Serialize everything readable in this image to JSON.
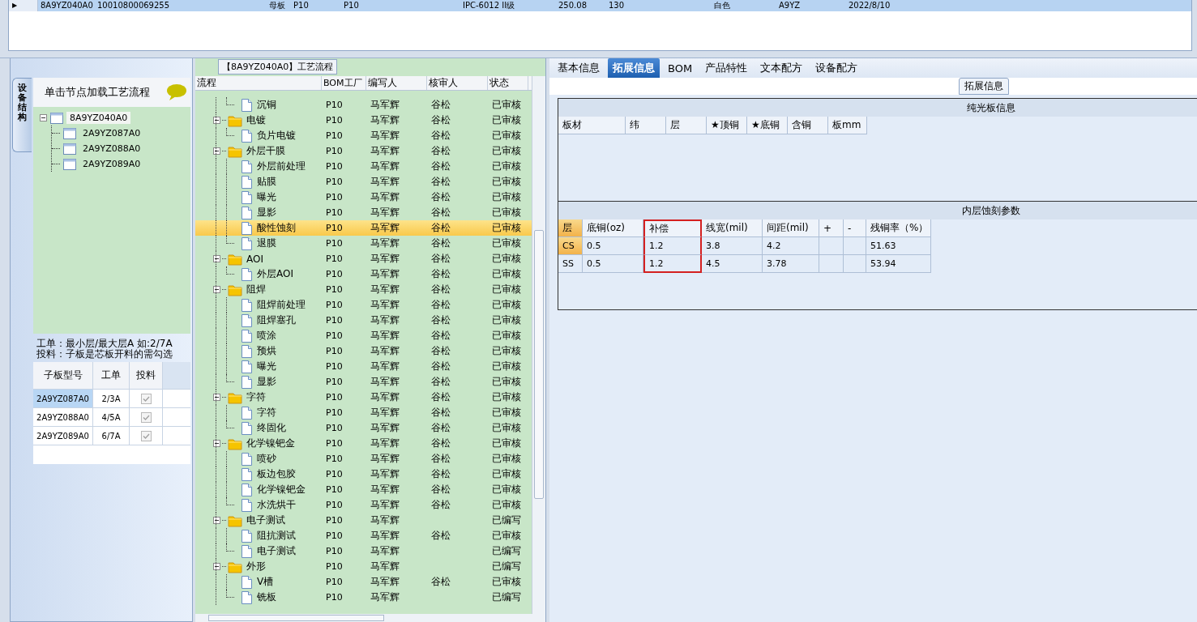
{
  "top_grid": {
    "rows": [
      {
        "selected": true,
        "marker": "▶",
        "cells": [
          "8A9YZ040A0",
          "10010800069255",
          "母板",
          "P10",
          "P10",
          "IPC-6012 II级",
          "250.08",
          "130",
          "白色",
          "A9YZ",
          "2022/8/10"
        ]
      }
    ]
  },
  "left_panel": {
    "side_tab": "设备结构",
    "header": "单击节点加载工艺流程",
    "tree": [
      {
        "label": "8A9YZ040A0",
        "expanded": true,
        "selected": true,
        "children": [
          {
            "label": "2A9YZ087A0",
            "selected": false
          },
          {
            "label": "2A9YZ088A0",
            "selected": false
          },
          {
            "label": "2A9YZ089A0",
            "selected": false
          }
        ]
      }
    ],
    "note": [
      "工单：最小层/最大层A 如:2/7A",
      "投料：子板是芯板开料的需勾选"
    ],
    "sub_table": {
      "columns": [
        "子板型号",
        "工单",
        "投料"
      ],
      "rows": [
        {
          "model": "2A9YZ087A0",
          "order": "2/3A",
          "checked": true,
          "selected": true
        },
        {
          "model": "2A9YZ088A0",
          "order": "4/5A",
          "checked": true,
          "selected": false
        },
        {
          "model": "2A9YZ089A0",
          "order": "6/7A",
          "checked": true,
          "selected": false
        }
      ]
    }
  },
  "flow_panel": {
    "title": "【8A9YZ040A0】工艺流程",
    "columns": [
      "流程",
      "BOM工厂",
      "编写人",
      "核审人",
      "状态"
    ],
    "tree": [
      {
        "children": [
          {
            "name": "沉铜",
            "bom": "P10",
            "writer": "马军辉",
            "reviewer": "谷松",
            "status": "已审核",
            "selected": false
          }
        ]
      },
      {
        "name": "电镀",
        "bom": "P10",
        "writer": "马军辉",
        "reviewer": "谷松",
        "status": "已审核",
        "expanded": true,
        "selected": false,
        "children": [
          {
            "name": "负片电镀",
            "bom": "P10",
            "writer": "马军辉",
            "reviewer": "谷松",
            "status": "已审核",
            "selected": false
          }
        ]
      },
      {
        "name": "外层干膜",
        "bom": "P10",
        "writer": "马军辉",
        "reviewer": "谷松",
        "status": "已审核",
        "expanded": true,
        "selected": false,
        "children": [
          {
            "name": "外层前处理",
            "bom": "P10",
            "writer": "马军辉",
            "reviewer": "谷松",
            "status": "已审核",
            "selected": false
          },
          {
            "name": "贴膜",
            "bom": "P10",
            "writer": "马军辉",
            "reviewer": "谷松",
            "status": "已审核",
            "selected": false
          },
          {
            "name": "曝光",
            "bom": "P10",
            "writer": "马军辉",
            "reviewer": "谷松",
            "status": "已审核",
            "selected": false
          },
          {
            "name": "显影",
            "bom": "P10",
            "writer": "马军辉",
            "reviewer": "谷松",
            "status": "已审核",
            "selected": false
          },
          {
            "name": "酸性蚀刻",
            "bom": "P10",
            "writer": "马军辉",
            "reviewer": "谷松",
            "status": "已审核",
            "selected": true
          },
          {
            "name": "退膜",
            "bom": "P10",
            "writer": "马军辉",
            "reviewer": "谷松",
            "status": "已审核",
            "selected": false
          }
        ]
      },
      {
        "name": "AOI",
        "bom": "P10",
        "writer": "马军辉",
        "reviewer": "谷松",
        "status": "已审核",
        "expanded": true,
        "selected": false,
        "children": [
          {
            "name": "外层AOI",
            "bom": "P10",
            "writer": "马军辉",
            "reviewer": "谷松",
            "status": "已审核",
            "selected": false
          }
        ]
      },
      {
        "name": "阻焊",
        "bom": "P10",
        "writer": "马军辉",
        "reviewer": "谷松",
        "status": "已审核",
        "expanded": true,
        "selected": false,
        "children": [
          {
            "name": "阻焊前处理",
            "bom": "P10",
            "writer": "马军辉",
            "reviewer": "谷松",
            "status": "已审核",
            "selected": false
          },
          {
            "name": "阻焊塞孔",
            "bom": "P10",
            "writer": "马军辉",
            "reviewer": "谷松",
            "status": "已审核",
            "selected": false
          },
          {
            "name": "喷涂",
            "bom": "P10",
            "writer": "马军辉",
            "reviewer": "谷松",
            "status": "已审核",
            "selected": false
          },
          {
            "name": "预烘",
            "bom": "P10",
            "writer": "马军辉",
            "reviewer": "谷松",
            "status": "已审核",
            "selected": false
          },
          {
            "name": "曝光",
            "bom": "P10",
            "writer": "马军辉",
            "reviewer": "谷松",
            "status": "已审核",
            "selected": false
          },
          {
            "name": "显影",
            "bom": "P10",
            "writer": "马军辉",
            "reviewer": "谷松",
            "status": "已审核",
            "selected": false
          }
        ]
      },
      {
        "name": "字符",
        "bom": "P10",
        "writer": "马军辉",
        "reviewer": "谷松",
        "status": "已审核",
        "expanded": true,
        "selected": false,
        "children": [
          {
            "name": "字符",
            "bom": "P10",
            "writer": "马军辉",
            "reviewer": "谷松",
            "status": "已审核",
            "selected": false
          },
          {
            "name": "终固化",
            "bom": "P10",
            "writer": "马军辉",
            "reviewer": "谷松",
            "status": "已审核",
            "selected": false
          }
        ]
      },
      {
        "name": "化学镍钯金",
        "bom": "P10",
        "writer": "马军辉",
        "reviewer": "谷松",
        "status": "已审核",
        "expanded": true,
        "selected": false,
        "children": [
          {
            "name": "喷砂",
            "bom": "P10",
            "writer": "马军辉",
            "reviewer": "谷松",
            "status": "已审核",
            "selected": false
          },
          {
            "name": "板边包胶",
            "bom": "P10",
            "writer": "马军辉",
            "reviewer": "谷松",
            "status": "已审核",
            "selected": false
          },
          {
            "name": "化学镍钯金",
            "bom": "P10",
            "writer": "马军辉",
            "reviewer": "谷松",
            "status": "已审核",
            "selected": false
          },
          {
            "name": "水洗烘干",
            "bom": "P10",
            "writer": "马军辉",
            "reviewer": "谷松",
            "status": "已审核",
            "selected": false
          }
        ]
      },
      {
        "name": "电子测试",
        "bom": "P10",
        "writer": "马军辉",
        "status": "已编写",
        "expanded": true,
        "selected": false,
        "children": [
          {
            "name": "阻抗测试",
            "bom": "P10",
            "writer": "马军辉",
            "reviewer": "谷松",
            "status": "已审核",
            "selected": false
          },
          {
            "name": "电子测试",
            "bom": "P10",
            "writer": "马军辉",
            "status": "已编写",
            "selected": false
          }
        ]
      },
      {
        "name": "外形",
        "bom": "P10",
        "writer": "马军辉",
        "status": "已编写",
        "expanded": true,
        "selected": false,
        "children": [
          {
            "name": "V槽",
            "bom": "P10",
            "writer": "马军辉",
            "reviewer": "谷松",
            "status": "已审核",
            "selected": false
          },
          {
            "name": "铣板",
            "bom": "P10",
            "writer": "马军辉",
            "status": "已编写",
            "selected": false
          }
        ]
      }
    ]
  },
  "detail_panel": {
    "tabs": [
      {
        "label": "基本信息",
        "selected": false
      },
      {
        "label": "拓展信息",
        "selected": true
      },
      {
        "label": "BOM",
        "selected": false
      },
      {
        "label": "产品特性",
        "selected": false
      },
      {
        "label": "文本配方",
        "selected": false
      },
      {
        "label": "设备配方",
        "selected": false
      }
    ],
    "group_title": "拓展信息",
    "sections": [
      {
        "title": "纯光板信息",
        "columns": [
          {
            "label": "板材"
          },
          {
            "label": "纬"
          },
          {
            "label": "层"
          },
          {
            "label": "★顶铜"
          },
          {
            "label": "★底铜"
          },
          {
            "label": "含铜"
          },
          {
            "label": "板mm"
          }
        ]
      },
      {
        "title": "内层蚀刻参数",
        "columns": [
          {
            "label": "层"
          },
          {
            "label": "底铜(oz)"
          },
          {
            "label": "补偿",
            "highlighted": true
          },
          {
            "label": "线宽(mil)"
          },
          {
            "label": "间距(mil)"
          },
          {
            "label": "+"
          },
          {
            "label": "-"
          },
          {
            "label": "残铜率（%）"
          }
        ],
        "rows": [
          {
            "selected": true,
            "cells": [
              "CS",
              "0.5",
              "1.2",
              "3.8",
              "4.2",
              "",
              "",
              "51.63"
            ]
          },
          {
            "selected": false,
            "cells": [
              "SS",
              "0.5",
              "1.2",
              "4.5",
              "3.78",
              "",
              "",
              "53.94"
            ]
          }
        ]
      }
    ]
  }
}
